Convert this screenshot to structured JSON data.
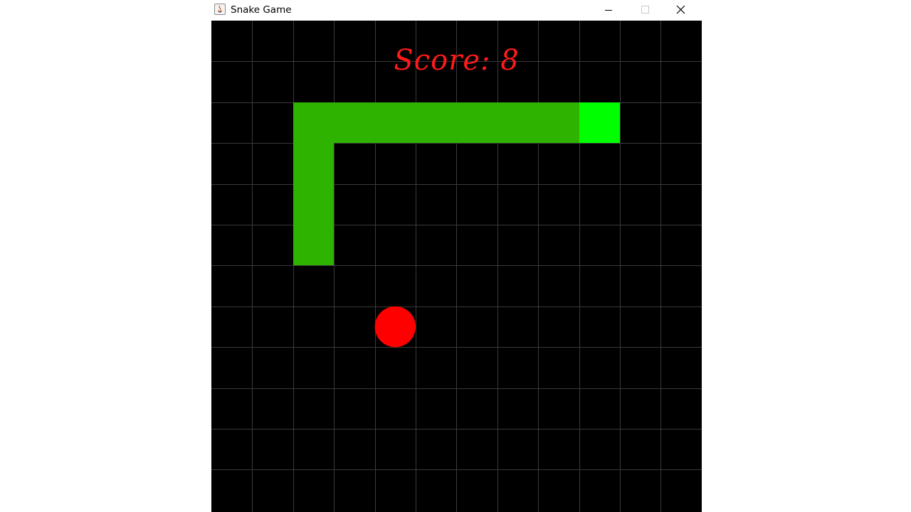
{
  "window": {
    "title": "Snake Game",
    "minimize_icon": "minimize-icon",
    "maximize_icon": "maximize-icon",
    "close_icon": "close-icon",
    "app_icon": "java-icon"
  },
  "game": {
    "score_label": "Score:",
    "score_value": "8",
    "grid": {
      "cols": 12,
      "rows": 12
    },
    "snake": {
      "head": [
        9,
        2
      ],
      "body": [
        [
          8,
          2
        ],
        [
          7,
          2
        ],
        [
          6,
          2
        ],
        [
          5,
          2
        ],
        [
          4,
          2
        ],
        [
          3,
          2
        ],
        [
          2,
          2
        ],
        [
          2,
          3
        ],
        [
          2,
          4
        ],
        [
          2,
          5
        ]
      ]
    },
    "food": [
      4,
      7
    ],
    "colors": {
      "background": "#000000",
      "grid_line": "#3a3a3a",
      "snake_body": "#2db300",
      "snake_head": "#00ff00",
      "food": "#ff0000",
      "score": "#ff1a1a"
    }
  }
}
